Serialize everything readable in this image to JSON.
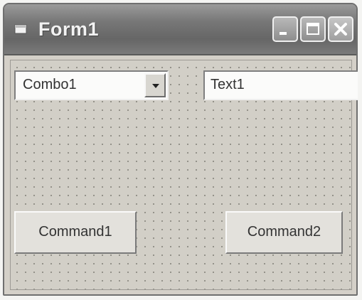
{
  "window": {
    "title": "Form1",
    "controls": [
      "minimize-icon",
      "maximize-icon",
      "close-icon"
    ]
  },
  "combo": {
    "value": "Combo1",
    "icon": "chevron-down-icon"
  },
  "textbox": {
    "value": "Text1"
  },
  "buttons": {
    "command1_label": "Command1",
    "command2_label": "Command2"
  },
  "colors": {
    "titlebar": "#777777",
    "form_background": "#d4d0c8",
    "field_background": "#fbfbfa"
  }
}
